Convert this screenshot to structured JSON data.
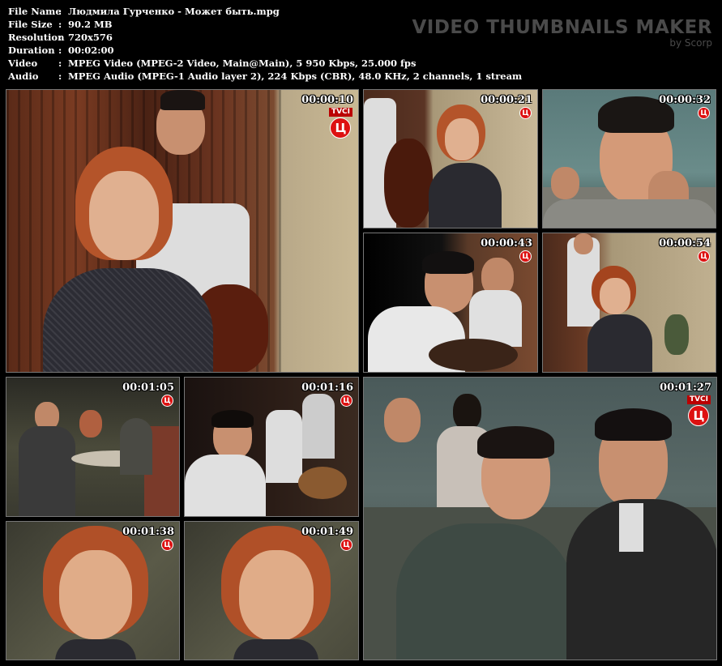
{
  "info": {
    "rows": [
      {
        "label": "File Name",
        "value": "Людмила Гурченко - Может быть.mpg"
      },
      {
        "label": "File Size",
        "value": "90.2 MB"
      },
      {
        "label": "Resolution",
        "value": "720x576"
      },
      {
        "label": "Duration",
        "value": "00:02:00"
      },
      {
        "label": "Video",
        "value": "MPEG Video (MPEG-2 Video, Main@Main), 5 950 Kbps, 25.000 fps"
      },
      {
        "label": "Audio",
        "value": "MPEG Audio (MPEG-1 Audio layer 2), 224 Kbps (CBR), 48.0 KHz, 2 channels, 1 stream"
      }
    ],
    "separator": ":"
  },
  "brand": {
    "title": "VIDEO THUMBNAILS MAKER",
    "subtitle": "by Scorp"
  },
  "channel_logo": {
    "text": "TVCI",
    "glyph": "Ц"
  },
  "thumbnails": [
    {
      "time": "00:00:10"
    },
    {
      "time": "00:00:21"
    },
    {
      "time": "00:00:32"
    },
    {
      "time": "00:00:43"
    },
    {
      "time": "00:00:54"
    },
    {
      "time": "00:01:05"
    },
    {
      "time": "00:01:16"
    },
    {
      "time": "00:01:27"
    },
    {
      "time": "00:01:38"
    },
    {
      "time": "00:01:49"
    }
  ],
  "colors": {
    "background": "#000000",
    "border": "#777777",
    "logo_red": "#d11111"
  }
}
